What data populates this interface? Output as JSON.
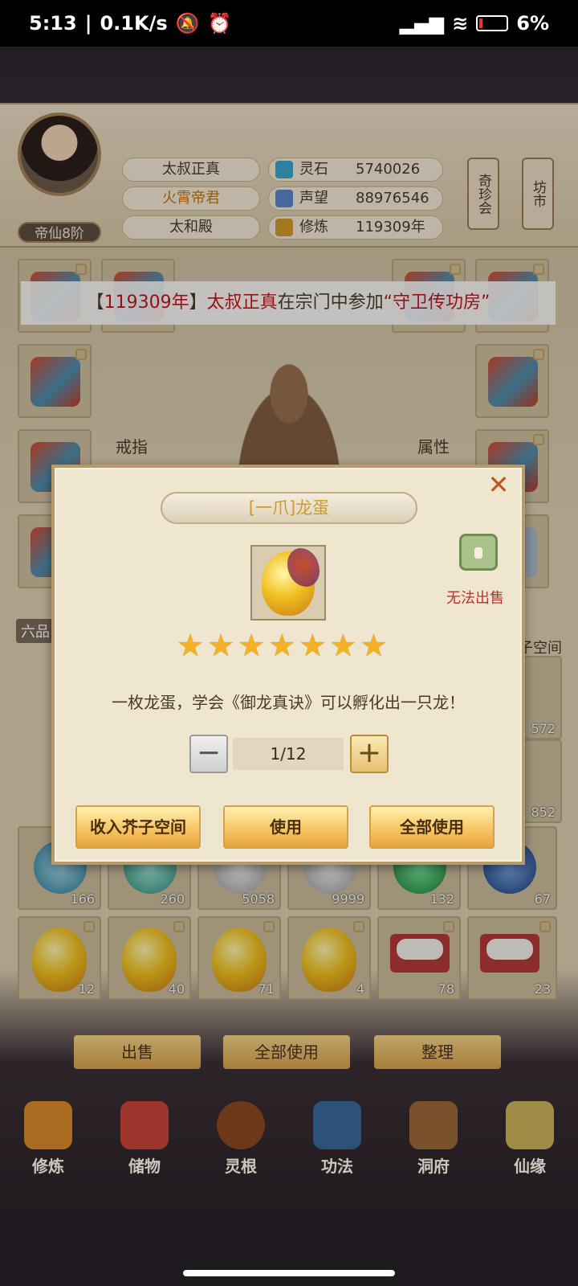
{
  "status_bar": {
    "time": "5:13",
    "net_speed": "0.1K/s",
    "battery": "6%"
  },
  "header": {
    "rank": "帝仙8阶",
    "rows": [
      "太叔正真",
      "火霄帝君",
      "太和殿"
    ],
    "resources": [
      {
        "label": "灵石",
        "value": "5740026",
        "icon": "spirit-stone-icon",
        "color": "#3aa6c9"
      },
      {
        "label": "声望",
        "value": "88976546",
        "icon": "reputation-icon",
        "color": "#5a86c9"
      },
      {
        "label": "修炼",
        "value": "119309年",
        "icon": "meditation-icon",
        "color": "#d09a2a"
      }
    ],
    "side_buttons": [
      "奇珍会",
      "坊市"
    ]
  },
  "marquee": {
    "bracket_open": "【",
    "year": "119309年",
    "bracket_close": "】",
    "name": "太叔正真",
    "text": "在宗门中参加",
    "event": "“守卫传功房”"
  },
  "equipment": {
    "ring_label": "戒指",
    "attr_label": "属性",
    "space_label": "子空间"
  },
  "inventory": {
    "tier_label": "六品",
    "orb_counts": [
      "166",
      "260",
      "5058",
      "9999",
      "132",
      "67"
    ],
    "egg_counts": [
      "12",
      "40",
      "71",
      "4"
    ],
    "rice_counts": [
      "78",
      "23"
    ],
    "side_counts": [
      "572",
      "852"
    ]
  },
  "bottom_actions": [
    "出售",
    "全部使用",
    "整理"
  ],
  "nav": [
    {
      "label": "修炼",
      "icon": "cultivation-icon",
      "color": "#d98a2a"
    },
    {
      "label": "储物",
      "icon": "storage-bag-icon",
      "color": "#c9443a"
    },
    {
      "label": "灵根",
      "icon": "spirit-root-icon",
      "color": "#8a4a22"
    },
    {
      "label": "功法",
      "icon": "manual-book-icon",
      "color": "#3a6a9a"
    },
    {
      "label": "洞府",
      "icon": "cave-house-icon",
      "color": "#9a6a3a"
    },
    {
      "label": "仙缘",
      "icon": "fate-gourd-icon",
      "color": "#c9b25a"
    }
  ],
  "modal": {
    "title": "[一爪]龙蛋",
    "no_sell_label": "无法出售",
    "stars": 7,
    "description": "一枚龙蛋，学会《御龙真诀》可以孵化出一只龙！",
    "quantity": "1/12",
    "minus": "−",
    "plus": "+",
    "buttons": [
      "收入芥子空间",
      "使用",
      "全部使用"
    ],
    "close": "✕"
  }
}
